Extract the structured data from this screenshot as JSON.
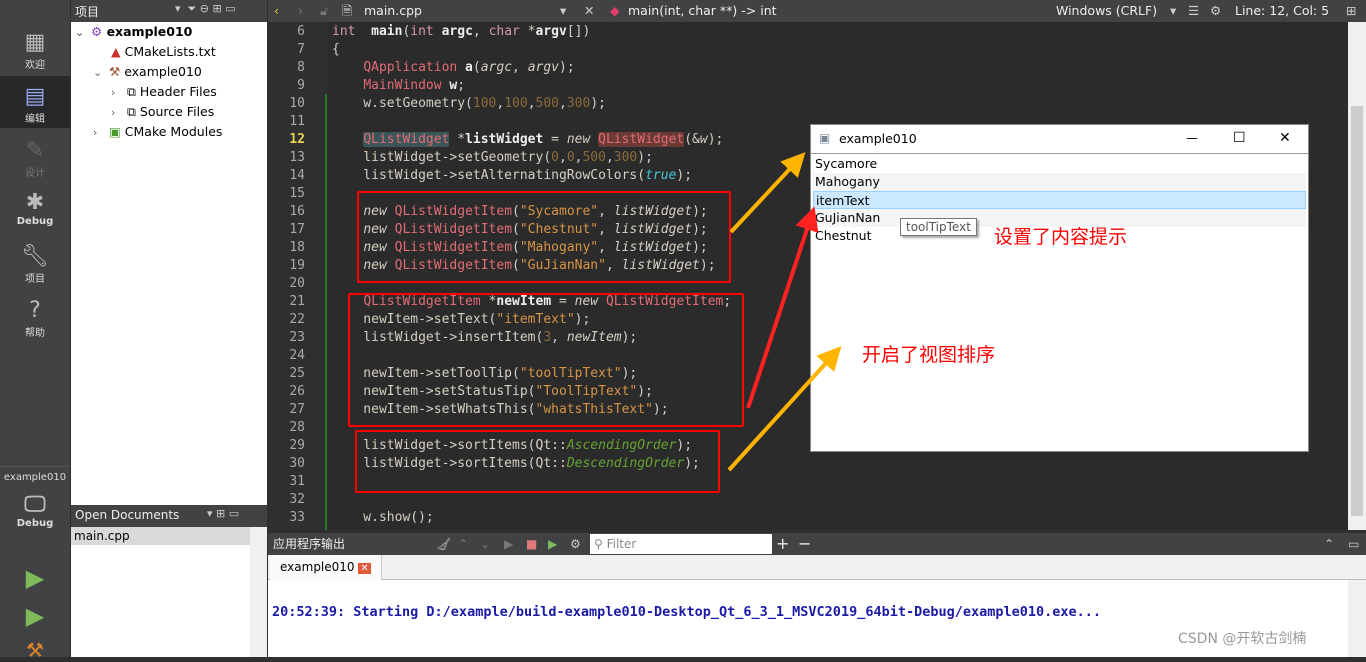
{
  "modebar": {
    "items": [
      {
        "label": "欢迎",
        "icon": "grid-icon"
      },
      {
        "label": "编辑",
        "icon": "edit-icon"
      },
      {
        "label": "设计",
        "icon": "pencil-icon"
      },
      {
        "label": "Debug",
        "icon": "bug-icon"
      },
      {
        "label": "项目",
        "icon": "wrench-icon"
      },
      {
        "label": "帮助",
        "icon": "help-icon"
      }
    ],
    "kit_name": "example010",
    "kit_mode": "Debug"
  },
  "project": {
    "title": "项目",
    "tree": [
      "example010",
      "CMakeLists.txt",
      "example010",
      "Header Files",
      "Source Files",
      "CMake Modules"
    ]
  },
  "open_docs": {
    "title": "Open Documents",
    "items": [
      "main.cpp"
    ]
  },
  "editor": {
    "file": "main.cpp",
    "symbol": "main(int, char **) -> int",
    "encoding": "Windows (CRLF)",
    "position": "Line: 12, Col: 5",
    "current_line": 12,
    "lines": [
      {
        "n": 6,
        "t": [
          [
            "kw",
            "int"
          ],
          [
            "",
            "  "
          ],
          [
            "b",
            "main"
          ],
          [
            "",
            "("
          ],
          [
            "kw",
            "int"
          ],
          [
            "b",
            " argc"
          ],
          [
            "",
            ", "
          ],
          [
            "kw",
            "char"
          ],
          [
            "",
            " *"
          ],
          [
            "b",
            "argv"
          ],
          [
            "",
            "[])"
          ]
        ]
      },
      {
        "n": 7,
        "t": [
          [
            "",
            "{"
          ]
        ]
      },
      {
        "n": 8,
        "t": [
          [
            "",
            "    "
          ],
          [
            "ty",
            "QApplication"
          ],
          [
            "b",
            " a"
          ],
          [
            "",
            "("
          ],
          [
            "it",
            "argc"
          ],
          [
            "",
            ", "
          ],
          [
            "it",
            "argv"
          ],
          [
            "",
            ");"
          ]
        ]
      },
      {
        "n": 9,
        "t": [
          [
            "",
            "    "
          ],
          [
            "ty",
            "MainWindow"
          ],
          [
            "b",
            " w"
          ],
          [
            "",
            ";"
          ]
        ]
      },
      {
        "n": 10,
        "t": [
          [
            "",
            "    w.setGeometry("
          ],
          [
            "num",
            "100"
          ],
          [
            "",
            ","
          ],
          [
            "num",
            "100"
          ],
          [
            "",
            ","
          ],
          [
            "num",
            "500"
          ],
          [
            "",
            ","
          ],
          [
            "num",
            "300"
          ],
          [
            "",
            ");"
          ]
        ]
      },
      {
        "n": 11,
        "t": []
      },
      {
        "n": 12,
        "t": [
          [
            "",
            "    "
          ],
          [
            "ty hl1",
            "QListWidget"
          ],
          [
            "",
            " *"
          ],
          [
            "b",
            "listWidget"
          ],
          [
            "",
            " = "
          ],
          [
            "it",
            "new"
          ],
          [
            "",
            " "
          ],
          [
            "ty hl2",
            "QListWidget"
          ],
          [
            "",
            "(&"
          ],
          [
            "it",
            "w"
          ],
          [
            "",
            ");"
          ]
        ]
      },
      {
        "n": 13,
        "t": [
          [
            "",
            "    listWidget->setGeometry("
          ],
          [
            "num",
            "0"
          ],
          [
            "",
            ","
          ],
          [
            "num",
            "0"
          ],
          [
            "",
            ","
          ],
          [
            "num",
            "500"
          ],
          [
            "",
            ","
          ],
          [
            "num",
            "300"
          ],
          [
            "",
            ");"
          ]
        ]
      },
      {
        "n": 14,
        "t": [
          [
            "",
            "    listWidget->setAlternatingRowColors("
          ],
          [
            "bl",
            "true"
          ],
          [
            "",
            ");"
          ]
        ]
      },
      {
        "n": 15,
        "t": []
      },
      {
        "n": 16,
        "t": [
          [
            "",
            "    "
          ],
          [
            "it",
            "new"
          ],
          [
            "",
            " "
          ],
          [
            "ty",
            "QListWidgetItem"
          ],
          [
            "",
            "("
          ],
          [
            "str",
            "\"Sycamore\""
          ],
          [
            "",
            ", "
          ],
          [
            "it",
            "listWidget"
          ],
          [
            "",
            ");"
          ]
        ]
      },
      {
        "n": 17,
        "t": [
          [
            "",
            "    "
          ],
          [
            "it",
            "new"
          ],
          [
            "",
            " "
          ],
          [
            "ty",
            "QListWidgetItem"
          ],
          [
            "",
            "("
          ],
          [
            "str",
            "\"Chestnut\""
          ],
          [
            "",
            ", "
          ],
          [
            "it",
            "listWidget"
          ],
          [
            "",
            ");"
          ]
        ]
      },
      {
        "n": 18,
        "t": [
          [
            "",
            "    "
          ],
          [
            "it",
            "new"
          ],
          [
            "",
            " "
          ],
          [
            "ty",
            "QListWidgetItem"
          ],
          [
            "",
            "("
          ],
          [
            "str",
            "\"Mahogany\""
          ],
          [
            "",
            ", "
          ],
          [
            "it",
            "listWidget"
          ],
          [
            "",
            ");"
          ]
        ]
      },
      {
        "n": 19,
        "t": [
          [
            "",
            "    "
          ],
          [
            "it",
            "new"
          ],
          [
            "",
            " "
          ],
          [
            "ty",
            "QListWidgetItem"
          ],
          [
            "",
            "("
          ],
          [
            "str",
            "\"GuJianNan\""
          ],
          [
            "",
            ", "
          ],
          [
            "it",
            "listWidget"
          ],
          [
            "",
            ");"
          ]
        ]
      },
      {
        "n": 20,
        "t": []
      },
      {
        "n": 21,
        "t": [
          [
            "",
            "    "
          ],
          [
            "ty",
            "QListWidgetItem"
          ],
          [
            "",
            " *"
          ],
          [
            "b",
            "newItem"
          ],
          [
            "",
            " = "
          ],
          [
            "it",
            "new"
          ],
          [
            "",
            " "
          ],
          [
            "ty",
            "QListWidgetItem"
          ],
          [
            "",
            ";"
          ]
        ]
      },
      {
        "n": 22,
        "t": [
          [
            "",
            "    newItem->setText("
          ],
          [
            "str",
            "\"itemText\""
          ],
          [
            "",
            ");"
          ]
        ]
      },
      {
        "n": 23,
        "t": [
          [
            "",
            "    listWidget->insertItem("
          ],
          [
            "num",
            "3"
          ],
          [
            "",
            ", "
          ],
          [
            "it",
            "newItem"
          ],
          [
            "",
            ");"
          ]
        ]
      },
      {
        "n": 24,
        "t": []
      },
      {
        "n": 25,
        "t": [
          [
            "",
            "    newItem->setToolTip("
          ],
          [
            "str",
            "\"toolTipText\""
          ],
          [
            "",
            ");"
          ]
        ]
      },
      {
        "n": 26,
        "t": [
          [
            "",
            "    newItem->setStatusTip("
          ],
          [
            "str",
            "\"ToolTipText\""
          ],
          [
            "",
            ");"
          ]
        ]
      },
      {
        "n": 27,
        "t": [
          [
            "",
            "    newItem->setWhatsThis("
          ],
          [
            "str",
            "\"whatsThisText\""
          ],
          [
            "",
            ");"
          ]
        ]
      },
      {
        "n": 28,
        "t": []
      },
      {
        "n": 29,
        "t": [
          [
            "",
            "    listWidget->sortItems(Qt::"
          ],
          [
            "en",
            "AscendingOrder"
          ],
          [
            "",
            ");"
          ]
        ]
      },
      {
        "n": 30,
        "t": [
          [
            "",
            "    listWidget->sortItems(Qt::"
          ],
          [
            "en",
            "DescendingOrder"
          ],
          [
            "",
            ");"
          ]
        ]
      },
      {
        "n": 31,
        "t": []
      },
      {
        "n": 32,
        "t": []
      },
      {
        "n": 33,
        "t": [
          [
            "",
            "    w.show();"
          ]
        ]
      }
    ]
  },
  "output": {
    "title": "应用程序输出",
    "filter_placeholder": "Filter",
    "tab": "example010",
    "text": "20:52:39: Starting D:/example/build-example010-Desktop_Qt_6_3_1_MSVC2019_64bit-Debug/example010.exe..."
  },
  "app_window": {
    "title": "example010",
    "items": [
      "Sycamore",
      "Mahogany",
      "itemText",
      "GuJianNan",
      "Chestnut"
    ],
    "selected": 2,
    "tooltip": "toolTipText"
  },
  "annotations": {
    "tooltip_note": "设置了内容提示",
    "sort_note": "开启了视图排序"
  },
  "watermark": "CSDN @开软古剑楠"
}
